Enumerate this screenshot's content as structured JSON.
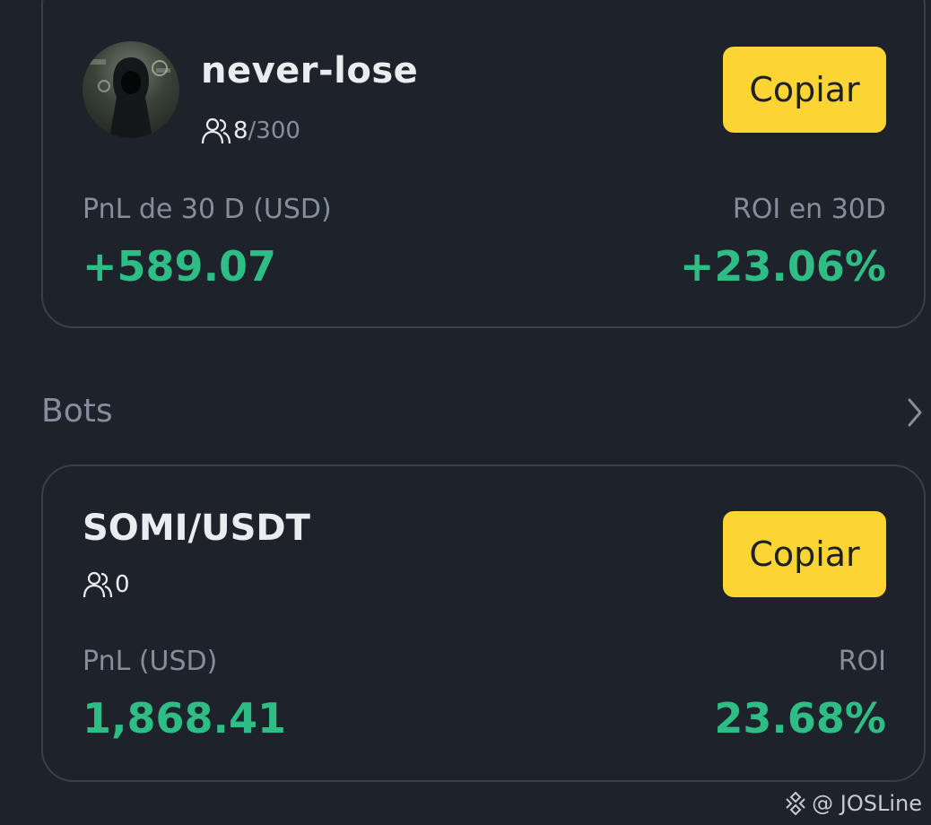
{
  "trader_card": {
    "name": "never-lose",
    "followers_count": "8",
    "followers_max": "/300",
    "copy_label": "Copiar",
    "pnl_label": "PnL de 30 D (USD)",
    "pnl_value": "+589.07",
    "roi_label": "ROI en 30D",
    "roi_value": "+23.06%"
  },
  "bots_section": {
    "title": "Bots"
  },
  "bot_card": {
    "pair": "SOMI/USDT",
    "followers_count": "0",
    "copy_label": "Copiar",
    "pnl_label": "PnL (USD)",
    "pnl_value": "1,868.41",
    "roi_label": "ROI",
    "roi_value": "23.68%"
  },
  "watermark": {
    "text": "@ JOSLine"
  },
  "colors": {
    "background": "#1e222a",
    "positive": "#2ebd85",
    "accent": "#fcd535",
    "muted": "#848e9c"
  },
  "icons": {
    "followers": "people-icon",
    "chevron": "chevron-right-icon",
    "brand": "binance-icon",
    "avatar": "hooded-figure-avatar"
  }
}
